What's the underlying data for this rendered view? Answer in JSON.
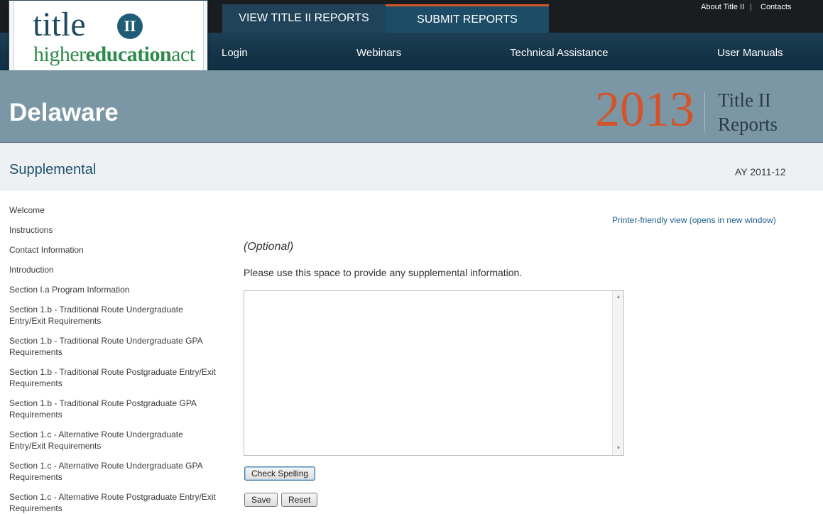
{
  "header": {
    "logo": {
      "title_word": "title",
      "badge": "II",
      "hea_prefix": "higher",
      "hea_bold": "education",
      "hea_suffix": "act"
    },
    "tabs": [
      {
        "label": "VIEW TITLE II REPORTS",
        "active": false
      },
      {
        "label": "SUBMIT REPORTS",
        "active": true
      }
    ],
    "utility_links": {
      "about": "About Title II",
      "separator": "|",
      "contacts": "Contacts"
    },
    "nav": {
      "login": "Login",
      "webinars": "Webinars",
      "technical_assistance": "Technical Assistance",
      "user_manuals": "User Manuals"
    }
  },
  "banner": {
    "state": "Delaware",
    "year": "2013",
    "report_title_line1": "Title II",
    "report_title_line2": "Reports"
  },
  "section": {
    "title": "Supplemental",
    "academic_year": "AY 2011-12"
  },
  "sidebar": {
    "items": [
      {
        "label": "Welcome"
      },
      {
        "label": "Instructions"
      },
      {
        "label": "Contact Information"
      },
      {
        "label": "Introduction"
      },
      {
        "label": "Section I.a Program Information"
      },
      {
        "label": "Section 1.b - Traditional Route Undergraduate Entry/Exit Requirements"
      },
      {
        "label": "Section 1.b - Traditional Route Undergraduate GPA Requirements"
      },
      {
        "label": "Section 1.b - Traditional Route Postgraduate Entry/Exit Requirements"
      },
      {
        "label": "Section 1.b - Traditional Route Postgraduate GPA Requirements"
      },
      {
        "label": "Section 1.c - Alternative Route Undergraduate Entry/Exit Requirements"
      },
      {
        "label": "Section 1.c - Alternative Route Undergraduate GPA Requirements"
      },
      {
        "label": "Section 1.c - Alternative Route Postgraduate Entry/Exit Requirements"
      }
    ]
  },
  "main": {
    "printer_link": "Printer-friendly view (opens in new window)",
    "optional_label": "(Optional)",
    "instructions": "Please use this space to provide any supplemental information.",
    "textarea_value": "",
    "buttons": {
      "check_spelling": "Check Spelling",
      "save": "Save",
      "reset": "Reset"
    }
  },
  "colors": {
    "accent_orange": "#d4542a",
    "banner_blue_gray": "#7b97a5",
    "nav_dark_blue": "#153347",
    "section_title_blue": "#1e4f6b"
  }
}
